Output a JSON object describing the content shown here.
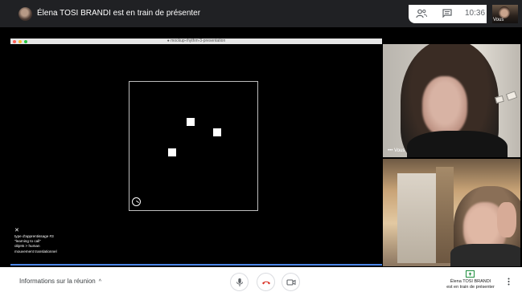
{
  "topbar": {
    "presenter_text": "Élena TOSI BRANDI est en train de présenter",
    "clock": "10:36",
    "self_label": "Vous"
  },
  "shared_window": {
    "title": "● mockup-rhythm-3-presentation",
    "info_lines": [
      "type d'apprentissage #3",
      "\"learning to call\"",
      "objets > human",
      "mouvement translationnel"
    ],
    "close_glyph": "✕"
  },
  "tiles": {
    "self_label": "••• Vous"
  },
  "bottombar": {
    "meeting_info": "Informations sur la réunion",
    "meeting_info_chevron": "^",
    "presenter_line1": "Élena TOSI BRANDI",
    "presenter_line2": "est en train de présenter"
  },
  "colors": {
    "topbar_bg": "#202124",
    "accent_blue": "#4b86e8",
    "hangup_red": "#d93025"
  },
  "icons": {
    "people": "people-icon",
    "chat": "chat-icon",
    "mic": "microphone-icon",
    "hangup": "hangup-icon",
    "camera": "camera-icon",
    "present": "present-screen-icon",
    "more": "more-vertical-icon"
  }
}
